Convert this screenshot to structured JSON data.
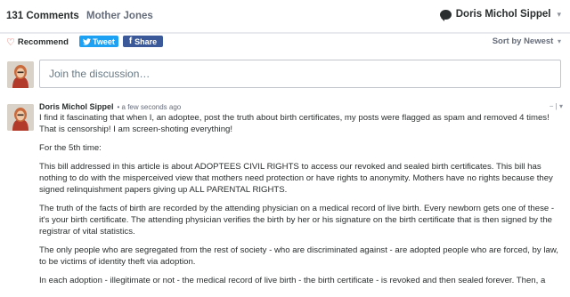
{
  "header": {
    "comments_count": "131 Comments",
    "site_name": "Mother Jones",
    "user_name": "Doris Michol Sippel"
  },
  "actions": {
    "recommend": "Recommend",
    "tweet": "Tweet",
    "share": "Share",
    "sort": "Sort by Newest"
  },
  "composer": {
    "placeholder": "Join the discussion…"
  },
  "comment": {
    "author": "Doris Michol Sippel",
    "time": "• a few seconds ago",
    "paragraphs": [
      "I find it fascinating that when I, an adoptee, post the truth about birth certificates, my posts were flagged as spam and removed 4 times! That is censorship! I am screen-shoting everything!",
      "For the 5th time:",
      "This bill addressed in this article is about ADOPTEES CIVIL RIGHTS to access our revoked and sealed birth certificates. This bill has nothing to do with the misperceived view that mothers need protection or have rights to anonymity. Mothers have no rights because they signed relinquishment papers giving up ALL PARENTAL RIGHTS.",
      "The truth of the facts of birth are recorded by the attending physician on a medical record of live birth. Every newborn gets one of these - it's your birth certificate. The attending physician verifies the birth by her or his signature on the birth certificate that is then signed by the registrar of vital statistics.",
      "The only people who are segregated from the rest of society - who are discriminated against - are adopted people who are forced, by law, to be victims of identity theft via adoption.",
      "In each adoption - illegitimate or not - the medical record of live birth - the birth certificate - is revoked and then sealed forever. Then, a"
    ]
  },
  "icons": {
    "heart": "heart-icon",
    "twitter": "twitter-bird-icon",
    "facebook": "facebook-f-icon",
    "chat": "chat-bubble-icon",
    "caret": "chevron-down-icon"
  },
  "colors": {
    "twitter": "#1da1f2",
    "facebook": "#3b5999",
    "heart": "#e04a3a"
  }
}
